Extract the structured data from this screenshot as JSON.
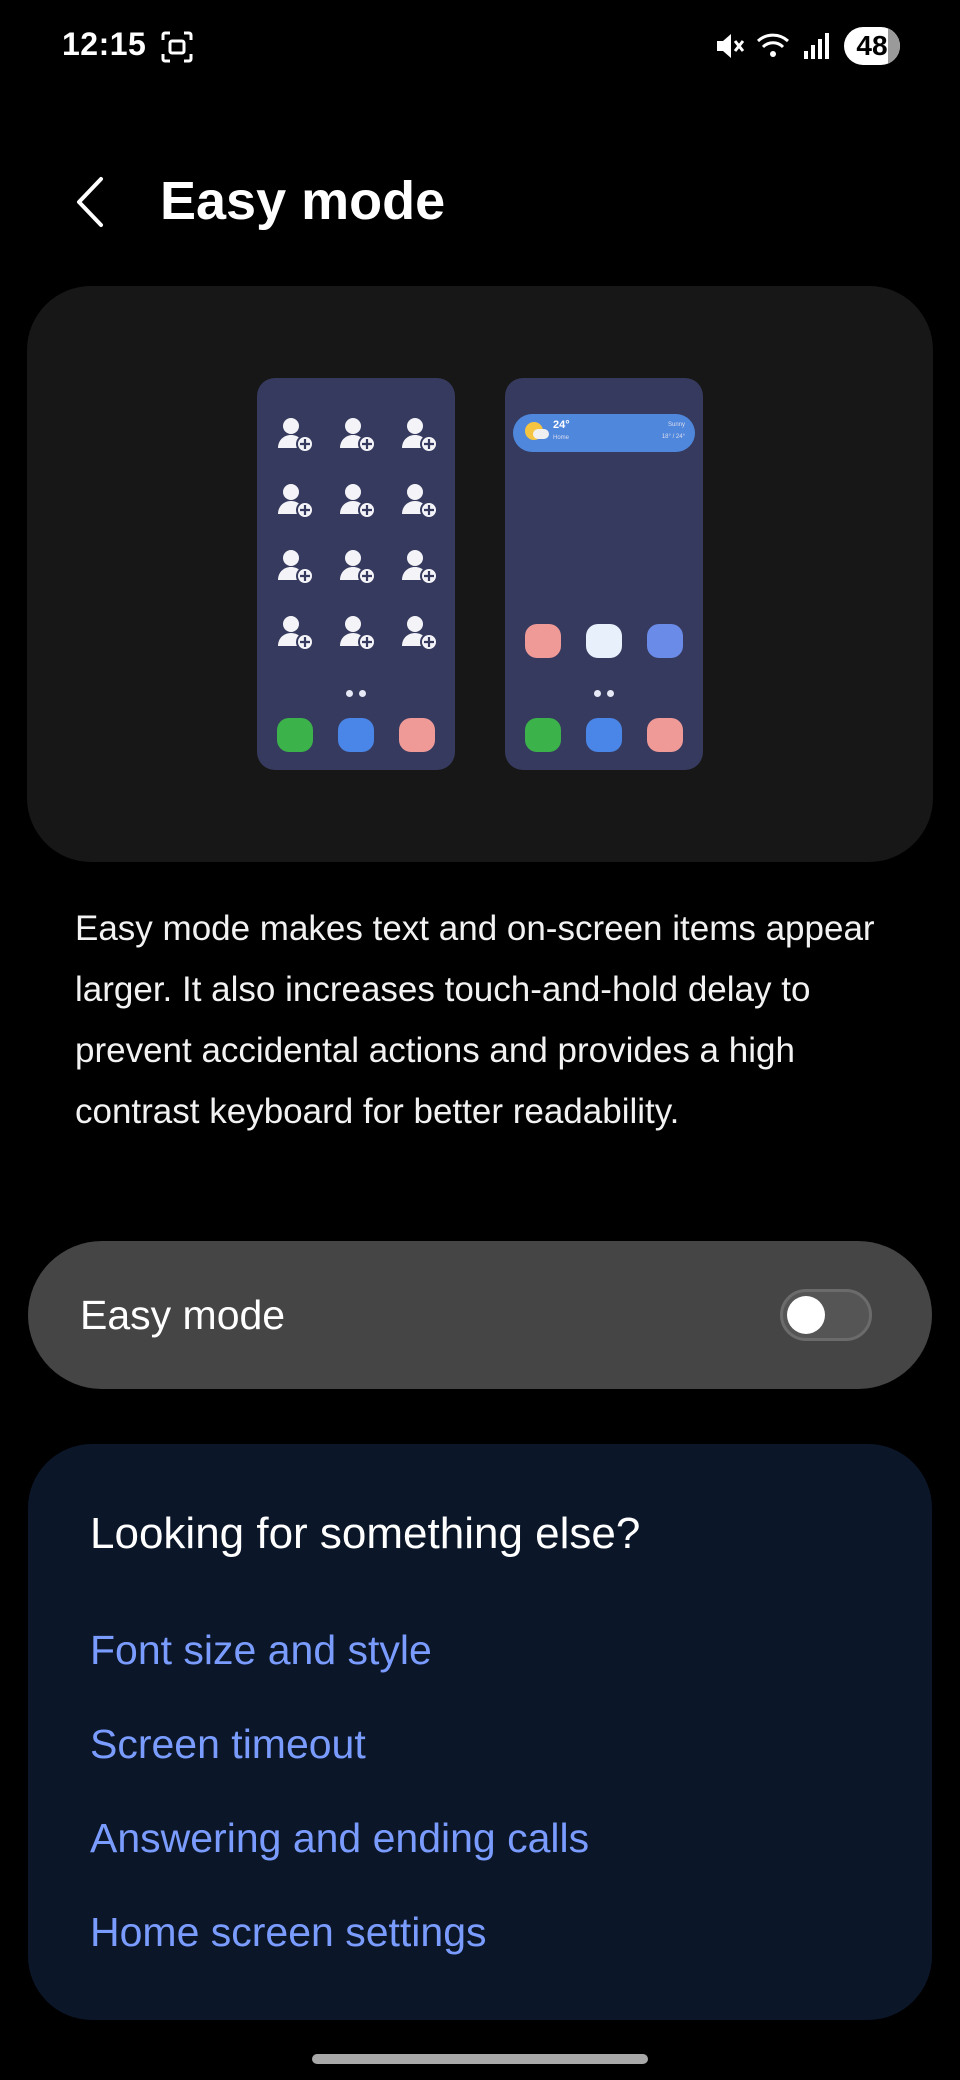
{
  "status_bar": {
    "time": "12:15",
    "battery": "48",
    "icons": [
      "screenshot-icon",
      "mute-icon",
      "wifi-icon",
      "signal-icon"
    ]
  },
  "header": {
    "title": "Easy mode",
    "back_icon": "chevron-left-icon"
  },
  "illustration": {
    "weather_temp": "24°",
    "weather_location": "Home",
    "weather_condition": "Sunny",
    "weather_high_low": "18° / 24°",
    "dock_colors": [
      "#3bb34a",
      "#4a86e8",
      "#f09a98"
    ],
    "app_colors": [
      "#f09a98",
      "#e8f0fb",
      "#6b8be8"
    ]
  },
  "description": "Easy mode makes text and on-screen items appear larger. It also increases touch-and-hold delay to prevent accidental actions and provides a high contrast keyboard for better readability.",
  "easy_mode_toggle": {
    "label": "Easy mode",
    "enabled": false
  },
  "suggestions": {
    "title": "Looking for something else?",
    "links": [
      "Font size and style",
      "Screen timeout",
      "Answering and ending calls",
      "Home screen settings"
    ]
  },
  "colors": {
    "accent_link": "#7a9cff",
    "card": "#171717",
    "toggle_row": "#454545",
    "suggest_card": "#0b1629"
  }
}
